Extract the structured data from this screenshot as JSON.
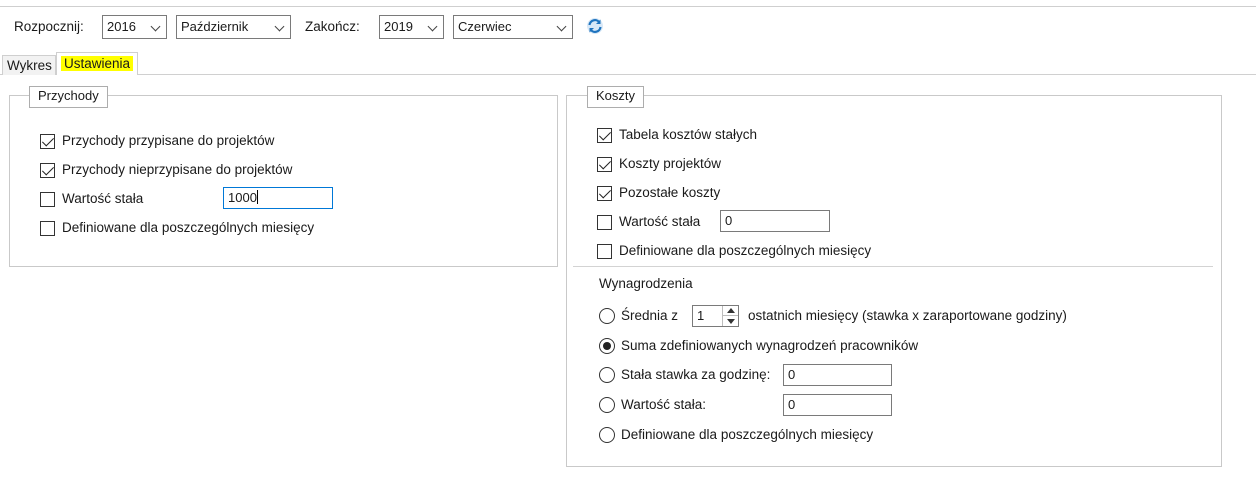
{
  "toolbar": {
    "start_label": "Rozpocznij:",
    "start_year": "2016",
    "start_month": "Październik",
    "end_label": "Zakończ:",
    "end_year": "2019",
    "end_month": "Czerwiec",
    "refresh_icon": "refresh-icon"
  },
  "tabs": [
    {
      "label": "Wykres",
      "active": false
    },
    {
      "label": "Ustawienia",
      "active": true,
      "highlight": "#ffff00"
    }
  ],
  "przychody": {
    "legend": "Przychody",
    "items": [
      {
        "label": "Przychody przypisane do projektów",
        "checked": true
      },
      {
        "label": "Przychody nieprzypisane do projektów",
        "checked": true
      },
      {
        "label": "Wartość stała",
        "checked": false
      },
      {
        "label": "Definiowane dla poszczególnych miesięcy",
        "checked": false
      }
    ],
    "fixed_value": "1000"
  },
  "koszty": {
    "legend": "Koszty",
    "items": [
      {
        "label": "Tabela kosztów stałych",
        "checked": true
      },
      {
        "label": "Koszty projektów",
        "checked": true
      },
      {
        "label": "Pozostałe koszty",
        "checked": true
      },
      {
        "label": "Wartość stała",
        "checked": false
      },
      {
        "label": "Definiowane dla poszczególnych miesięcy",
        "checked": false
      }
    ],
    "fixed_value": "0",
    "wynagrodzenia": {
      "title": "Wynagrodzenia",
      "avg_prefix": "Średnia z",
      "avg_months": "1",
      "avg_suffix": "ostatnich miesięcy (stawka x zaraportowane godziny)",
      "sum_label": "Suma zdefiniowanych wynagrodzeń pracowników",
      "rate_label": "Stała stawka za godzinę:",
      "rate_value": "0",
      "fixed_label": "Wartość stała:",
      "fixed_value": "0",
      "monthly_label": "Definiowane dla poszczególnych miesięcy",
      "selected": "sum"
    }
  },
  "colors": {
    "tab_highlight": "#ffff00",
    "focus_border": "#0078d7",
    "refresh_blue": "#1e73be"
  }
}
